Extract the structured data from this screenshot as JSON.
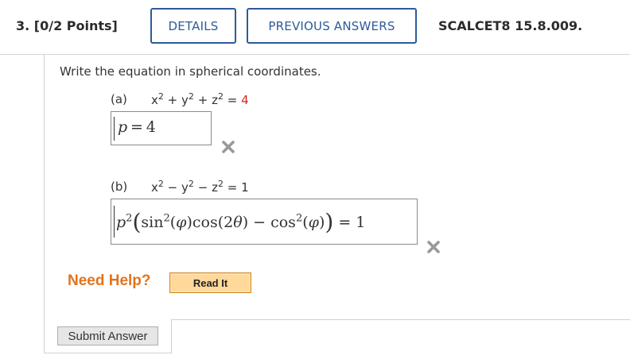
{
  "header": {
    "question_number": "3.",
    "points": "[0/2 Points]",
    "details_label": "DETAILS",
    "previous_answers_label": "PREVIOUS ANSWERS",
    "problem_id": "SCALCET8 15.8.009."
  },
  "question": {
    "prompt": "Write the equation in spherical coordinates.",
    "parts": [
      {
        "label": "(a)",
        "equation_lhs_terms": [
          "x",
          "y",
          "z"
        ],
        "exponent": "2",
        "operators": [
          "+",
          "+"
        ],
        "equals": "=",
        "rhs": "4",
        "answer": "p = 4",
        "status": "incorrect"
      },
      {
        "label": "(b)",
        "equation_lhs_terms": [
          "x",
          "y",
          "z"
        ],
        "exponent": "2",
        "operators": [
          "−",
          "−"
        ],
        "equals": "=",
        "rhs": "1",
        "answer": "p^2(sin^2(φ)cos(2θ) − cos^2(φ)) = 1",
        "status": "incorrect"
      }
    ]
  },
  "help": {
    "need_help_label": "Need Help?",
    "read_it_label": "Read It"
  },
  "submit_label": "Submit Answer",
  "colors": {
    "accent_blue": "#2c5b9a",
    "need_help_orange": "#e0741f",
    "incorrect_red": "#d42a1f",
    "x_mark_gray": "#999999"
  }
}
